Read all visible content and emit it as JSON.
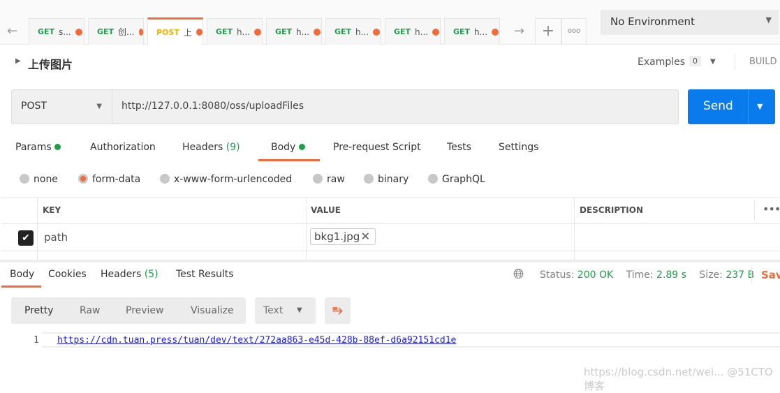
{
  "tabs": [
    {
      "method": "GET",
      "name": "s..."
    },
    {
      "method": "GET",
      "name": "创..."
    },
    {
      "method": "POST",
      "name": "上"
    },
    {
      "method": "GET",
      "name": "h..."
    },
    {
      "method": "GET",
      "name": "h..."
    },
    {
      "method": "GET",
      "name": "h..."
    },
    {
      "method": "GET",
      "name": "h..."
    },
    {
      "method": "GET",
      "name": "h..."
    }
  ],
  "environment": "No Environment",
  "request": {
    "title": "上传图片",
    "examples_label": "Examples",
    "examples_count": "0",
    "build_label": "BUILD",
    "method": "POST",
    "url": "http://127.0.0.1:8080/oss/uploadFiles",
    "send_label": "Send"
  },
  "req_tabs": {
    "params": "Params",
    "authorization": "Authorization",
    "headers": "Headers",
    "headers_count": "(9)",
    "body": "Body",
    "prerequest": "Pre-request Script",
    "tests": "Tests",
    "settings": "Settings"
  },
  "body_modes": [
    "none",
    "form-data",
    "x-www-form-urlencoded",
    "raw",
    "binary",
    "GraphQL"
  ],
  "selected_mode": "form-data",
  "table": {
    "headers": [
      "KEY",
      "VALUE",
      "DESCRIPTION"
    ],
    "rows": [
      {
        "checked": true,
        "key": "path",
        "value": "bkg1.jpg",
        "description": ""
      }
    ]
  },
  "response": {
    "tabs": {
      "body": "Body",
      "cookies": "Cookies",
      "headers": "Headers",
      "headers_count": "(5)",
      "tests": "Test Results"
    },
    "status_label": "Status:",
    "status": "200 OK",
    "time_label": "Time:",
    "time": "2.89 s",
    "size_label": "Size:",
    "size": "237 B",
    "save_label": "Save",
    "views": [
      "Pretty",
      "Raw",
      "Preview",
      "Visualize"
    ],
    "format": "Text",
    "lines": [
      {
        "n": "1",
        "text": "https://cdn.tuan.press/tuan/dev/text/272aa863-e45d-428b-88ef-d6a92151cd1e"
      }
    ]
  },
  "watermark": "https://blog.csdn.net/wei...  @51CTO博客",
  "colors": {
    "accent": "#f26b3a",
    "send": "#097bed",
    "success": "#1f9e4a"
  }
}
